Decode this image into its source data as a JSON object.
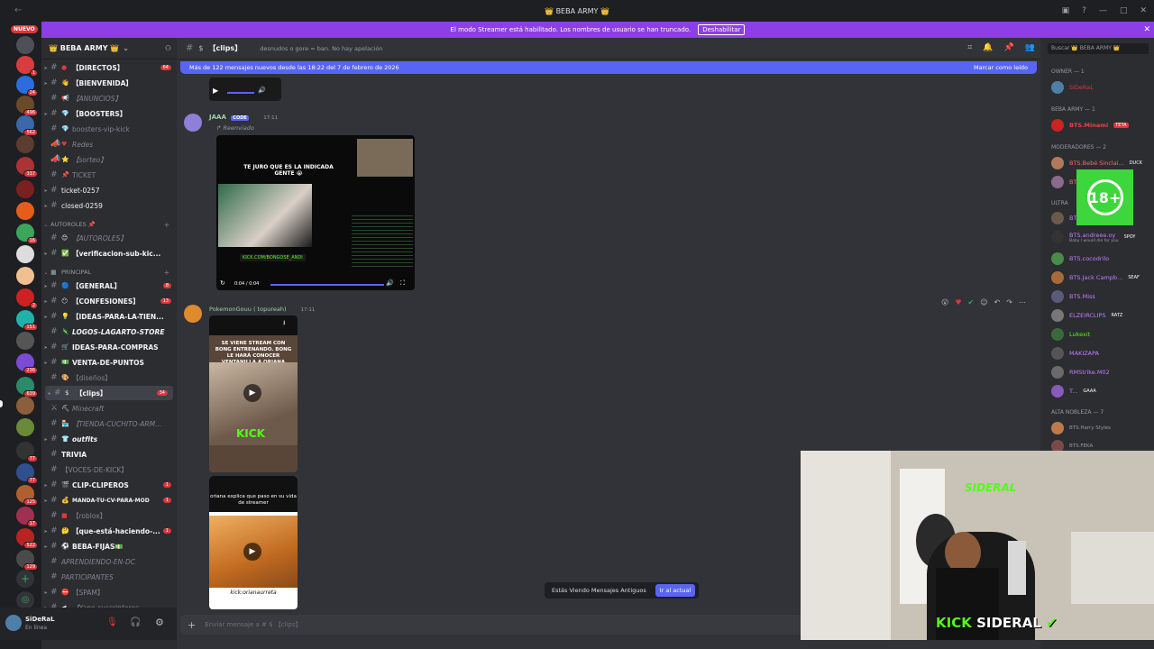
{
  "window": {
    "title": "👑 BEBA ARMY 👑"
  },
  "streamer_mode": {
    "message": "El modo Streamer está habilitado. Los nombres de usuario se han truncado.",
    "disable_label": "Deshabilitar"
  },
  "servers": {
    "new_label": "NUEVO"
  },
  "guild": {
    "name": "👑 BEBA ARMY 👑"
  },
  "channels": [
    {
      "name": "【DIRECTOS】",
      "badge": "64"
    },
    {
      "name": "【BIENVENIDA】"
    },
    {
      "name": "【ANUNCIOS】"
    },
    {
      "name": "【BOOSTERS】"
    },
    {
      "name": "boosters-vip-kick"
    },
    {
      "name": "Redes"
    },
    {
      "name": "【sorteo】"
    },
    {
      "name": "TICKET"
    },
    {
      "name": "ticket-0257"
    },
    {
      "name": "closed-0259"
    },
    {
      "name": "AUTOROLES 📌"
    },
    {
      "name": "【AUTOROLES】"
    },
    {
      "name": "【verificacion-sub-kic..."
    },
    {
      "name": "PRINCIPAL"
    },
    {
      "name": "【GENERAL】",
      "badge": "8"
    },
    {
      "name": "【CONFESIONES】",
      "badge": "13"
    },
    {
      "name": "【IDEAS-PARA-LA-TIEN..."
    },
    {
      "name": "LOGOS-LAGARTO-STORE"
    },
    {
      "name": "IDEAS-PARA-COMPRAS"
    },
    {
      "name": "VENTA-DE-PUNTOS"
    },
    {
      "name": "【diseños】"
    },
    {
      "name": "【clips】",
      "badge": "34"
    },
    {
      "name": "Minecraft"
    },
    {
      "name": "【TIENDA-CUCHITO-ARM..."
    },
    {
      "name": "outfits"
    },
    {
      "name": "TRIVIA"
    },
    {
      "name": "【VOCES-DE-KICK】"
    },
    {
      "name": "CLIP-CLIPEROS",
      "badge": "1"
    },
    {
      "name": "MANDA-TU-CV-PARA-MOD",
      "badge": "1"
    },
    {
      "name": "【roblox】"
    },
    {
      "name": "【que-está-haciendo-...",
      "badge": "1"
    },
    {
      "name": "BEBA-FIJAS💵"
    },
    {
      "name": "APRENDIENDO-EN-DC"
    },
    {
      "name": "PARTICIPANTES"
    },
    {
      "name": "【SPAM】"
    },
    {
      "name": "【Yape-suscriptores..."
    }
  ],
  "user_panel": {
    "name": "SiDeRaL",
    "status": "En línea"
  },
  "chat": {
    "channel_name": "【clips】",
    "topic": "desnudos o gore = ban. No hay apelación",
    "new_messages": "Más de 122 mensajes nuevos desde las 18:22 del 7 de febrero de 2026",
    "mark_read": "Marcar como leído",
    "messages": [
      {
        "author": "JAAA",
        "tag": "CODE",
        "time": "17:11",
        "forwarded": "Reenviado",
        "media_text": "TE JURO QUE ES LA INDICADA GENTE 😭",
        "media_link": "KICK.COM/BONGOSE_ANDI",
        "media_time": "0:04 / 0:04"
      },
      {
        "author": "PokemonGouu ( topureah)",
        "time": "17:11",
        "media1_text": "SE VIENE STREAM CON BONG ENTRENANDO. BONG LE HARÁ CONOCER VENTANILLA A ORIANA",
        "media1_brand": "KICK",
        "media2_text": "oriana explica que paso en su vida de streamer",
        "media2_caption": "kick:orianaurreta"
      }
    ],
    "jump": {
      "text": "Estás Viendo Mensajes Antiguos",
      "button": "Ir al actual"
    },
    "composer_placeholder": "Enviar mensaje a # $ 【clips】"
  },
  "members": {
    "search_placeholder": "Buscar 👑 BEBA ARMY 👑",
    "groups": [
      {
        "title": "OWNER — 1",
        "members": [
          "SiDeRaL"
        ]
      },
      {
        "title": "BEBA ARMY — 1",
        "members": [
          "BTS.Minami"
        ]
      },
      {
        "title": "MODERADORES — 2",
        "members": [
          "BTS.Bebé Sinclai...",
          "BTS.Xime"
        ]
      },
      {
        "title": "ULTRA",
        "members": [
          "BTS.Saaa",
          "BTS.andreee.oy",
          "BTS.cocodrilo",
          "BTS.Jack Campb...",
          "BTS.Miss",
          "ELZEIRCLIPS",
          "Lukexit",
          "MAKIZAPA",
          "RMStrike.M02",
          "T..."
        ]
      },
      {
        "title": "ALTA NOBLEZA — 7",
        "members": [
          "BTS.Harry Styles",
          "BTS.FEKA"
        ]
      }
    ],
    "tags": {
      "teta": "TETA",
      "duck": "DUCK",
      "spoy": "SPOY",
      "seaf": "SEAF",
      "ratz": "RATZ",
      "gaaa": "GAAA",
      "sub_status": "Baby I would die for you"
    }
  },
  "overlay": {
    "age_rating": "18+",
    "cam_caption_green": "KICK",
    "cam_caption_white": "SIDERAL",
    "cam_logo": "SIDERAL"
  },
  "colors": {
    "accent": "#5865f2",
    "streamer_bar": "#8c3fe6",
    "kick_green": "#53fc18",
    "danger": "#da373c"
  }
}
